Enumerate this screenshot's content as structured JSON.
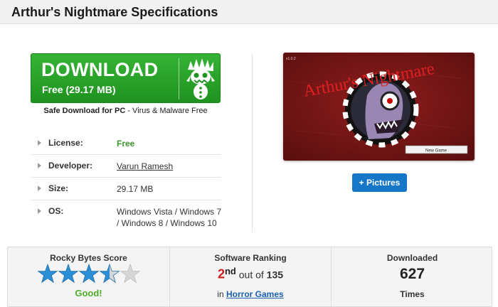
{
  "page": {
    "title": "Arthur's Nightmare Specifications"
  },
  "download": {
    "label": "DOWNLOAD",
    "sub": "Free (29.17 MB)",
    "icon": "monster-logo-icon"
  },
  "safe_notice": {
    "bold": "Safe Download for PC",
    "rest": " - Virus & Malware Free"
  },
  "specs": [
    {
      "key": "License:",
      "value": "Free"
    },
    {
      "key": "Developer:",
      "value": "Varun Ramesh"
    },
    {
      "key": "Size:",
      "value": "29.17 MB"
    },
    {
      "key": "OS:",
      "value": "Windows Vista / Windows 7 / Windows 8 / Windows 10"
    }
  ],
  "screenshot": {
    "version": "v1.0.2",
    "game_title": "Arthur's Nightmare",
    "button_label": "New Game"
  },
  "pictures_button": {
    "label": "+ Pictures"
  },
  "stats": {
    "score": {
      "title": "Rocky Bytes Score",
      "rating": 3.5,
      "max": 5,
      "word": "Good!"
    },
    "ranking": {
      "title": "Software Ranking",
      "rank": "2",
      "suffix": "nd",
      "out_of": " out of ",
      "total": "135",
      "in_label": "in ",
      "category": "Horror Games"
    },
    "downloaded": {
      "title": "Downloaded",
      "count": "627",
      "unit": "Times"
    }
  },
  "colors": {
    "download_green": "#27a027",
    "free_green": "#3a9a2a",
    "pictures_blue": "#1676c8",
    "star_blue": "#2a8fd6",
    "rank_red": "#cc1d1d",
    "good_green": "#4caf2a"
  }
}
